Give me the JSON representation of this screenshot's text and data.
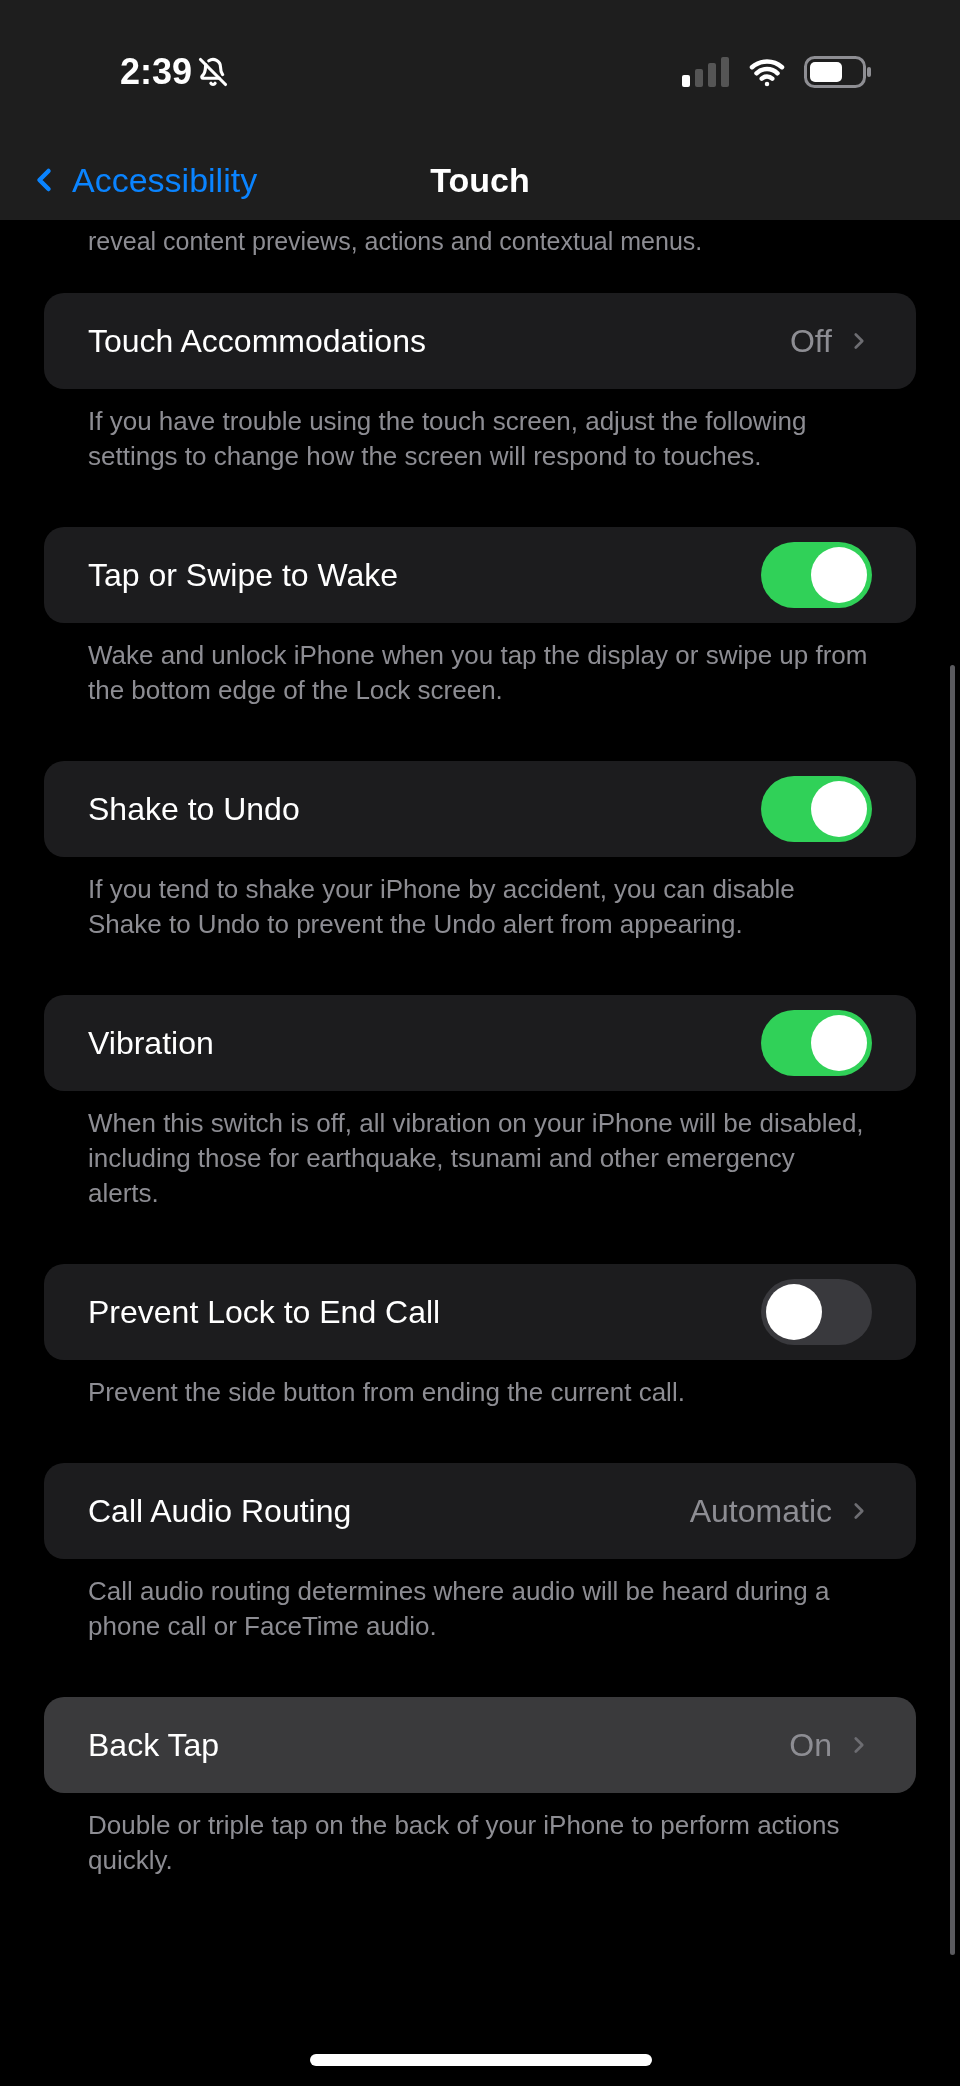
{
  "status_bar": {
    "time": "2:39"
  },
  "nav": {
    "back": "Accessibility",
    "title": "Touch"
  },
  "top_note": "reveal content previews, actions and contextual menus.",
  "rows": [
    {
      "kind": "link",
      "label": "Touch Accommodations",
      "value": "Off",
      "highlighted": false,
      "footer": "If you have trouble using the touch screen, adjust the following settings to change how the screen will respond to touches."
    },
    {
      "kind": "toggle",
      "label": "Tap or Swipe to Wake",
      "on": true,
      "footer": "Wake and unlock iPhone when you tap the display or swipe up from the bottom edge of the Lock screen."
    },
    {
      "kind": "toggle",
      "label": "Shake to Undo",
      "on": true,
      "footer": "If you tend to shake your iPhone by accident, you can disable Shake to Undo to prevent the Undo alert from appearing."
    },
    {
      "kind": "toggle",
      "label": "Vibration",
      "on": true,
      "footer": "When this switch is off, all vibration on your iPhone will be disabled, including those for earthquake, tsunami and other emergency alerts."
    },
    {
      "kind": "toggle",
      "label": "Prevent Lock to End Call",
      "on": false,
      "footer": "Prevent the side button from ending the current call."
    },
    {
      "kind": "link",
      "label": "Call Audio Routing",
      "value": "Automatic",
      "highlighted": false,
      "footer": "Call audio routing determines where audio will be heard during a phone call or FaceTime audio."
    },
    {
      "kind": "link",
      "label": "Back Tap",
      "value": "On",
      "highlighted": true,
      "footer": "Double or triple tap on the back of your iPhone to perform actions quickly."
    }
  ]
}
